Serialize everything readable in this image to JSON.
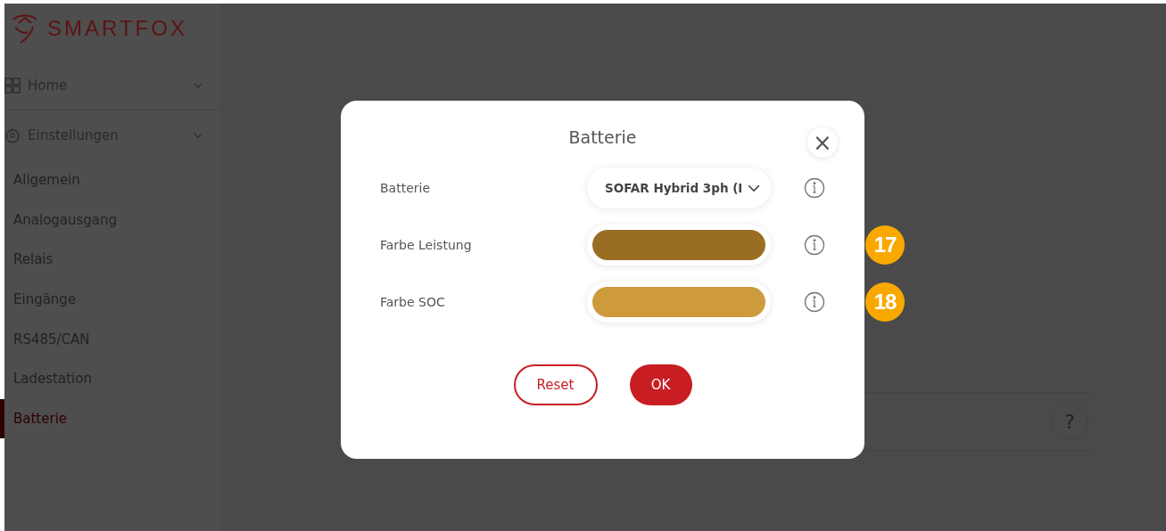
{
  "sidebar": {
    "logo": "SMARTFOX",
    "groups": [
      {
        "label": "Home"
      },
      {
        "label": "Einstellungen"
      }
    ],
    "items": [
      {
        "label": "Allgemein",
        "selected": false
      },
      {
        "label": "Analogausgang",
        "selected": false
      },
      {
        "label": "Relais",
        "selected": false
      },
      {
        "label": "Eingänge",
        "selected": false
      },
      {
        "label": "RS485/CAN",
        "selected": false
      },
      {
        "label": "Ladestation",
        "selected": false
      },
      {
        "label": "Batterie",
        "selected": true
      }
    ]
  },
  "help": {
    "label": "?"
  },
  "dialog": {
    "title": "Batterie",
    "close": "×",
    "fields": [
      {
        "kind": "select",
        "label": "Batterie",
        "value": "SOFAR Hybrid 3ph (I"
      },
      {
        "kind": "color",
        "label": "Farbe Leistung",
        "color": "#9a6e22",
        "badge": "17"
      },
      {
        "kind": "color",
        "label": "Farbe SOC",
        "color": "#cd9a3c",
        "badge": "18"
      }
    ],
    "buttons": [
      {
        "kind": "outline",
        "label": "Reset"
      },
      {
        "kind": "primary",
        "label": "OK"
      }
    ]
  }
}
